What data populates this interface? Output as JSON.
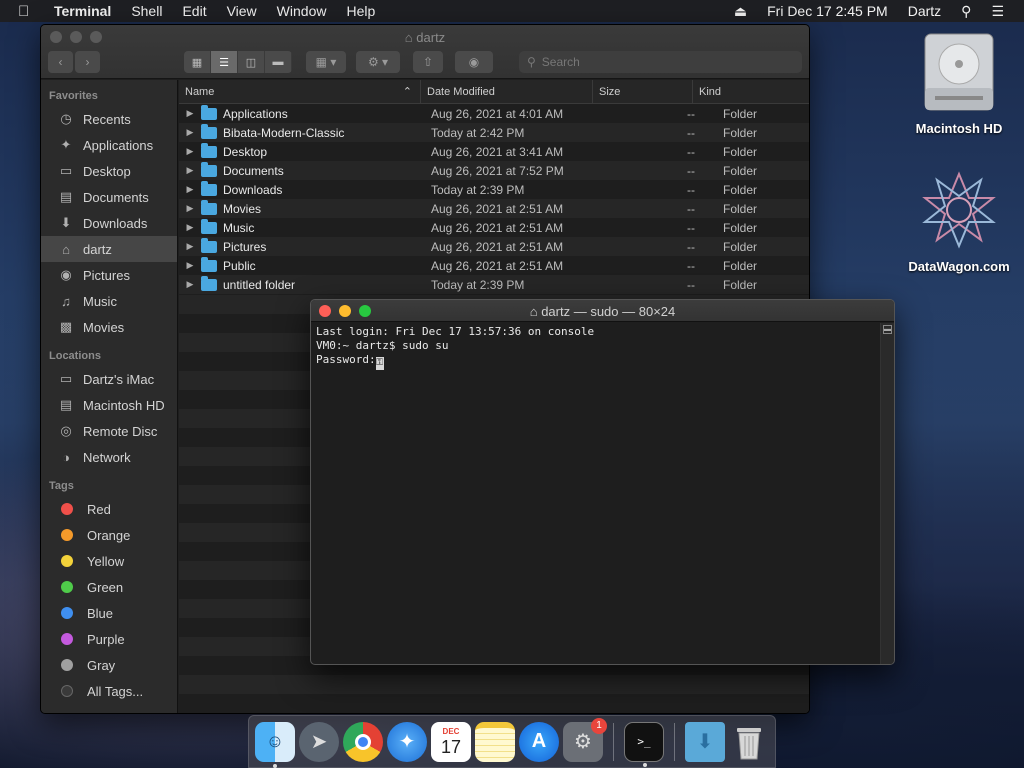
{
  "menubar": {
    "app": "Terminal",
    "items": [
      "Shell",
      "Edit",
      "View",
      "Window",
      "Help"
    ],
    "datetime": "Fri Dec 17  2:45 PM",
    "user": "Dartz"
  },
  "finder": {
    "title": "dartz",
    "search_placeholder": "Search",
    "sidebar": {
      "favorites_header": "Favorites",
      "favorites": [
        {
          "label": "Recents",
          "icon": "clock-icon"
        },
        {
          "label": "Applications",
          "icon": "applications-icon"
        },
        {
          "label": "Desktop",
          "icon": "desktop-icon"
        },
        {
          "label": "Documents",
          "icon": "document-icon"
        },
        {
          "label": "Downloads",
          "icon": "download-icon"
        },
        {
          "label": "dartz",
          "icon": "home-icon"
        },
        {
          "label": "Pictures",
          "icon": "camera-icon"
        },
        {
          "label": "Music",
          "icon": "music-icon"
        },
        {
          "label": "Movies",
          "icon": "film-icon"
        }
      ],
      "locations_header": "Locations",
      "locations": [
        {
          "label": "Dartz's iMac",
          "icon": "computer-icon"
        },
        {
          "label": "Macintosh HD",
          "icon": "disk-icon"
        },
        {
          "label": "Remote Disc",
          "icon": "disc-icon"
        },
        {
          "label": "Network",
          "icon": "globe-icon"
        }
      ],
      "tags_header": "Tags",
      "tags": [
        {
          "label": "Red",
          "color": "#f0504a"
        },
        {
          "label": "Orange",
          "color": "#f59a2a"
        },
        {
          "label": "Yellow",
          "color": "#f3d23a"
        },
        {
          "label": "Green",
          "color": "#4fcb4a"
        },
        {
          "label": "Blue",
          "color": "#3f8ff0"
        },
        {
          "label": "Purple",
          "color": "#c45ade"
        },
        {
          "label": "Gray",
          "color": "#a0a0a0"
        },
        {
          "label": "All Tags...",
          "color": "#3a3a3a"
        }
      ]
    },
    "columns": {
      "name": "Name",
      "date": "Date Modified",
      "size": "Size",
      "kind": "Kind"
    },
    "rows": [
      {
        "name": "Applications",
        "date": "Aug 26, 2021 at 4:01 AM",
        "size": "--",
        "kind": "Folder"
      },
      {
        "name": "Bibata-Modern-Classic",
        "date": "Today at 2:42 PM",
        "size": "--",
        "kind": "Folder"
      },
      {
        "name": "Desktop",
        "date": "Aug 26, 2021 at 3:41 AM",
        "size": "--",
        "kind": "Folder"
      },
      {
        "name": "Documents",
        "date": "Aug 26, 2021 at 7:52 PM",
        "size": "--",
        "kind": "Folder"
      },
      {
        "name": "Downloads",
        "date": "Today at 2:39 PM",
        "size": "--",
        "kind": "Folder"
      },
      {
        "name": "Movies",
        "date": "Aug 26, 2021 at 2:51 AM",
        "size": "--",
        "kind": "Folder"
      },
      {
        "name": "Music",
        "date": "Aug 26, 2021 at 2:51 AM",
        "size": "--",
        "kind": "Folder"
      },
      {
        "name": "Pictures",
        "date": "Aug 26, 2021 at 2:51 AM",
        "size": "--",
        "kind": "Folder"
      },
      {
        "name": "Public",
        "date": "Aug 26, 2021 at 2:51 AM",
        "size": "--",
        "kind": "Folder"
      },
      {
        "name": "untitled folder",
        "date": "Today at 2:39 PM",
        "size": "--",
        "kind": "Folder"
      }
    ]
  },
  "terminal": {
    "title": "dartz — sudo — 80×24",
    "line1": "Last login: Fri Dec 17 13:57:36 on console",
    "line2": "VM0:~ dartz$ sudo su",
    "line3": "Password:"
  },
  "desktop": {
    "icons": [
      {
        "label": "Macintosh HD"
      },
      {
        "label": "DataWagon.com"
      }
    ]
  },
  "dock": {
    "calendar_month": "DEC",
    "calendar_day": "17",
    "prefs_badge": "1"
  }
}
